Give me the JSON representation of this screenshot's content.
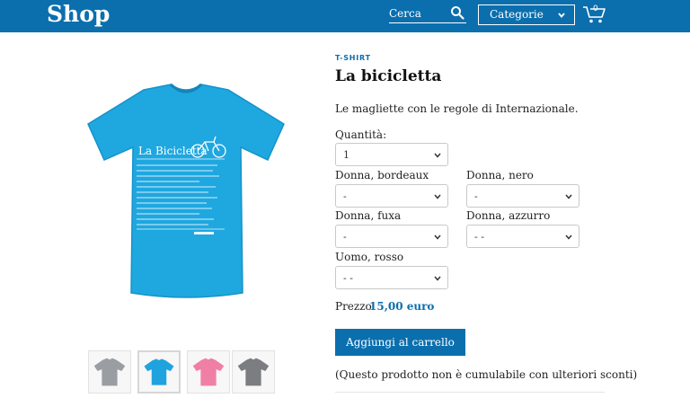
{
  "header": {
    "logo": "Shop",
    "search_placeholder": "Cerca",
    "categories_label": "Categorie",
    "cart_count": "0",
    "accent_color": "#0b6fae"
  },
  "product": {
    "category": "T-SHIRT",
    "title": "La bicicletta",
    "description": "Le magliette con le regole di Internazionale.",
    "shirt_print_title": "La Bicicletta",
    "quantity_label": "Quantità:",
    "quantity_value": "1",
    "variants": [
      {
        "label": "Donna, bordeaux",
        "value": "-"
      },
      {
        "label": "Donna, nero",
        "value": "-"
      },
      {
        "label": "Donna, fuxa",
        "value": "-"
      },
      {
        "label": "Donna, azzurro",
        "value": "- -"
      },
      {
        "label": "Uomo, rosso",
        "value": "- -"
      }
    ],
    "price_label": "Prezzo:",
    "price_value": "15,00 euro",
    "add_to_cart": "Aggiungi al carrello",
    "note": "(Questo prodotto non è cumulabile con ulteriori sconti)",
    "thumbnails": [
      {
        "name": "thumb-grey",
        "color": "#9a9ea3"
      },
      {
        "name": "thumb-blue",
        "color": "#1fa3de"
      },
      {
        "name": "thumb-pink",
        "color": "#f07fa6"
      },
      {
        "name": "thumb-darkgrey",
        "color": "#7b7d80"
      }
    ],
    "shirt_color": "#1fa7df"
  }
}
